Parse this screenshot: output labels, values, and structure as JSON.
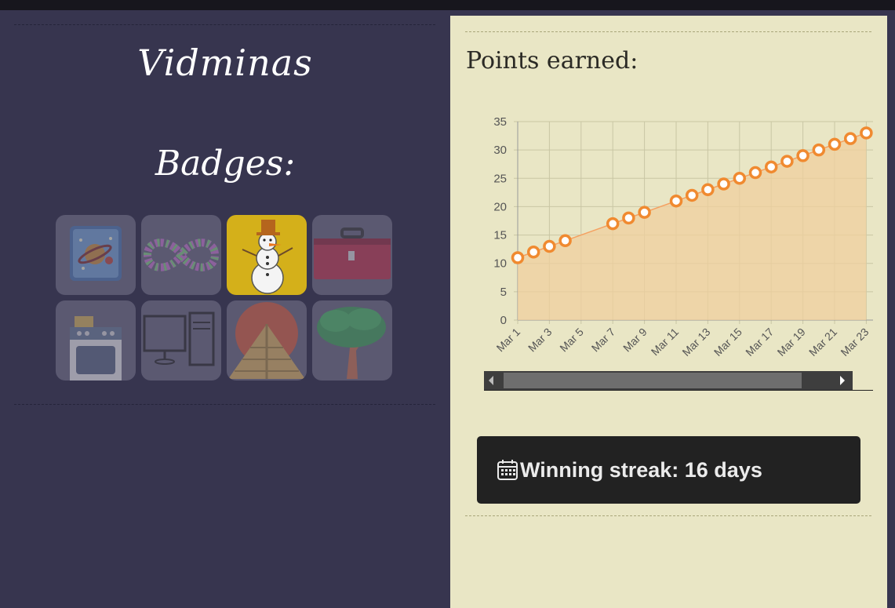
{
  "profile": {
    "username": "Vidminas",
    "badges_title": "Badges:"
  },
  "badges": [
    {
      "name": "planet",
      "active": false
    },
    {
      "name": "infinity",
      "active": false
    },
    {
      "name": "snowman",
      "active": true
    },
    {
      "name": "toolbox",
      "active": false
    },
    {
      "name": "oven",
      "active": false
    },
    {
      "name": "computer",
      "active": false
    },
    {
      "name": "pyramid",
      "active": false
    },
    {
      "name": "tree",
      "active": false
    }
  ],
  "points": {
    "title": "Points earned:"
  },
  "streak": {
    "icon": "calendar-icon",
    "text": "Winning streak: 16 days"
  },
  "colors": {
    "line": "#f5a060",
    "marker": "#f08a30",
    "area": "#efcf9e"
  },
  "chart_data": {
    "type": "area",
    "x": [
      "Mar 1",
      "Mar 2",
      "Mar 3",
      "Mar 4",
      "Mar 5",
      "Mar 6",
      "Mar 7",
      "Mar 8",
      "Mar 9",
      "Mar 10",
      "Mar 11",
      "Mar 12",
      "Mar 13",
      "Mar 14",
      "Mar 15",
      "Mar 16",
      "Mar 17",
      "Mar 18",
      "Mar 19",
      "Mar 20",
      "Mar 21",
      "Mar 22",
      "Mar 23"
    ],
    "series": [
      {
        "values": [
          11,
          12,
          13,
          14,
          null,
          null,
          17,
          18,
          19,
          null,
          21,
          22,
          23,
          24,
          25,
          26,
          27,
          28,
          29,
          30,
          31,
          32,
          33
        ]
      }
    ],
    "tick_labels_x": [
      "Mar 1",
      "Mar 3",
      "Mar 5",
      "Mar 7",
      "Mar 9",
      "Mar 11",
      "Mar 13",
      "Mar 15",
      "Mar 17",
      "Mar 19",
      "Mar 21",
      "Mar 23"
    ],
    "yticks": [
      0,
      5,
      10,
      15,
      20,
      25,
      30,
      35
    ],
    "ylim": [
      0,
      35
    ],
    "grid": true,
    "legend": "none",
    "scrollable": true
  }
}
